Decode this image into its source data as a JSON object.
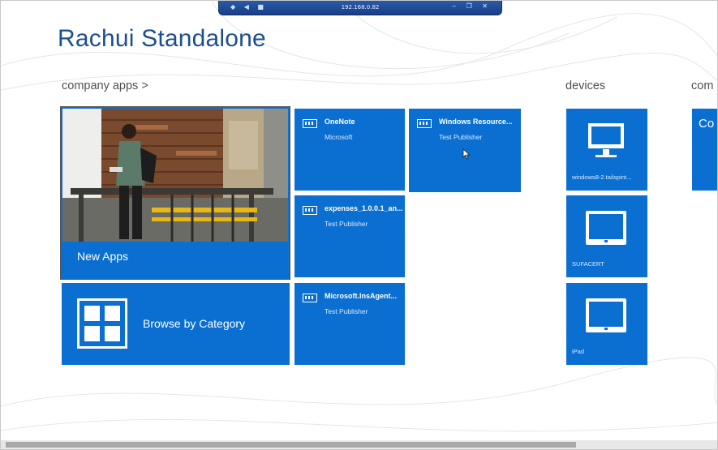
{
  "remote_bar": {
    "title": "192.168.0.82",
    "left_controls": "◆ ◀ ■",
    "right_controls": "‒ ❐ ✕"
  },
  "app": {
    "title": "Rachui Standalone"
  },
  "groups": {
    "company_apps": "company apps >",
    "devices": "devices",
    "partial": "com"
  },
  "tiles": {
    "new_apps": "New Apps",
    "browse": "Browse by Category",
    "apps": [
      {
        "name": "OneNote",
        "publisher": "Microsoft"
      },
      {
        "name": "Windows Resource...",
        "publisher": "Test Publisher"
      },
      {
        "name": "expenses_1.0.0.1_an...",
        "publisher": "Test Publisher"
      },
      {
        "name": "Microsoft.InsAgent...",
        "publisher": "Test Publisher"
      }
    ],
    "devices": [
      {
        "name": "windows8-2.tailspint...",
        "icon": "monitor-icon"
      },
      {
        "name": "SUFACERT",
        "icon": "tablet-icon"
      },
      {
        "name": "iPad",
        "icon": "tablet-icon"
      }
    ],
    "partial_tile": "Co"
  },
  "colors": {
    "tile": "#0a6fd1",
    "title": "#1d4f8c"
  }
}
